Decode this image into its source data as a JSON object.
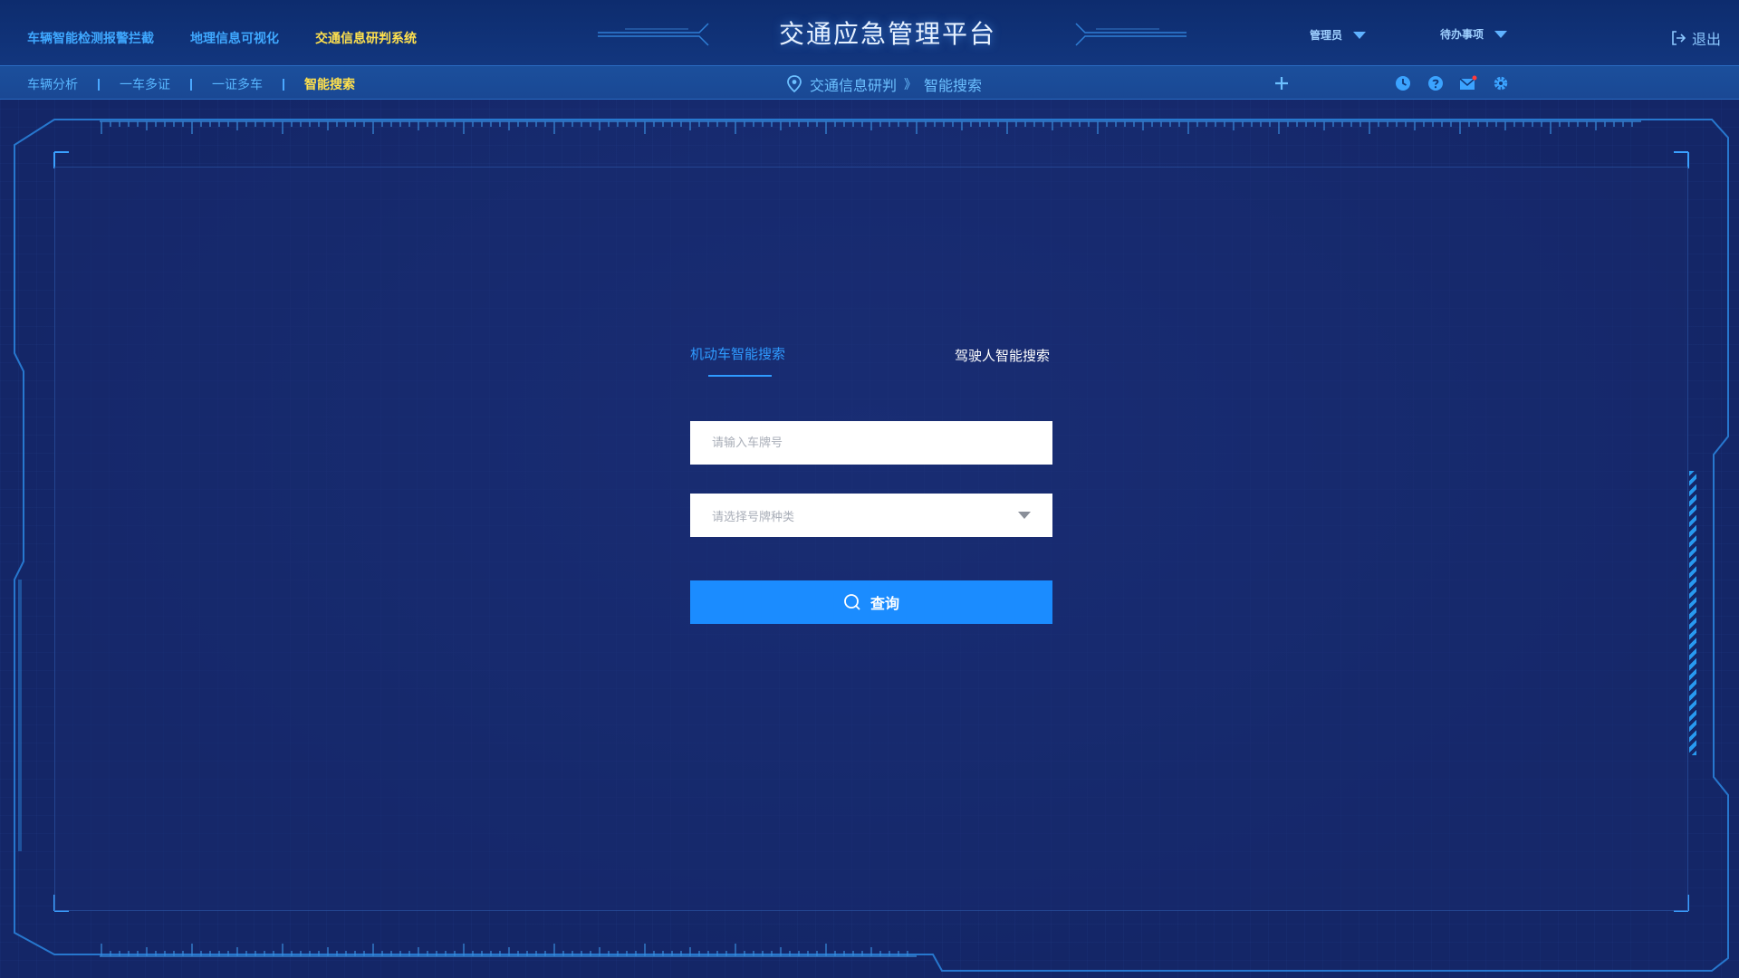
{
  "header": {
    "title": "交通应急管理平台",
    "systems": [
      {
        "label": "车辆智能检测报警拦截",
        "active": false
      },
      {
        "label": "地理信息可视化",
        "active": false
      },
      {
        "label": "交通信息研判系统",
        "active": true
      }
    ],
    "user_label": "管理员",
    "todo_label": "待办事项",
    "logout_label": "退出"
  },
  "subnav": {
    "items": [
      {
        "label": "车辆分析",
        "active": false
      },
      {
        "label": "一车多证",
        "active": false
      },
      {
        "label": "一证多车",
        "active": false
      },
      {
        "label": "智能搜索",
        "active": true
      }
    ],
    "breadcrumb": [
      "交通信息研判",
      "智能搜索"
    ],
    "breadcrumb_separator": "》",
    "tools": [
      "add-icon",
      "clock-icon",
      "help-icon",
      "mail-icon",
      "settings-icon"
    ]
  },
  "search": {
    "tabs": [
      {
        "label": "机动车智能搜索",
        "active": true
      },
      {
        "label": "驾驶人智能搜索",
        "active": false
      }
    ],
    "plate_placeholder": "请输入车牌号",
    "plate_value": "",
    "plate_type_placeholder": "请选择号牌种类",
    "query_label": "查询"
  },
  "colors": {
    "background": "#142667",
    "accent": "#1b8cff",
    "active_nav": "#ffe14d",
    "nav_text": "#3fa8ff"
  }
}
